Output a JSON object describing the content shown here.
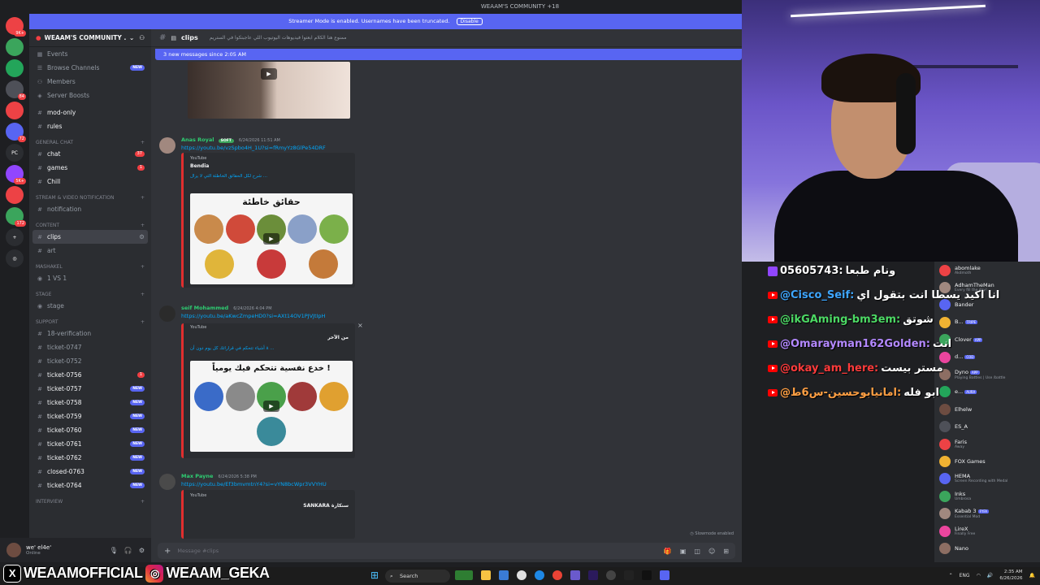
{
  "window": {
    "title": "WEAAM'S COMMUNITY +18"
  },
  "streamer_banner": {
    "text": "Streamer Mode is enabled. Usernames have been truncated.",
    "disable_label": "Disable"
  },
  "servers": [
    {
      "label": "",
      "badge": "9K+"
    },
    {
      "label": "",
      "badge": ""
    },
    {
      "label": "",
      "badge": ""
    },
    {
      "label": "",
      "badge": "84"
    },
    {
      "label": "",
      "badge": ""
    },
    {
      "label": "",
      "badge": "72"
    },
    {
      "label": "PC",
      "badge": ""
    },
    {
      "label": "",
      "badge": "5K+"
    },
    {
      "label": "",
      "badge": ""
    },
    {
      "label": "",
      "badge": "172"
    },
    {
      "label": "+",
      "badge": ""
    },
    {
      "label": "◎",
      "badge": ""
    }
  ],
  "sidebar": {
    "server_name": "WEAAM'S COMMUNITY ...",
    "top_items": [
      {
        "label": "Events",
        "icon": "calendar-icon",
        "new": ""
      },
      {
        "label": "Browse Channels",
        "icon": "browse-icon",
        "new": "NEW"
      },
      {
        "label": "Members",
        "icon": "members-icon",
        "new": ""
      },
      {
        "label": "Server Boosts",
        "icon": "boost-icon",
        "new": ""
      }
    ],
    "channels_a": [
      {
        "label": "mod-only",
        "unread": true
      },
      {
        "label": "rules",
        "unread": true
      }
    ],
    "cat_general": "GENERAL CHAT",
    "general": [
      {
        "label": "chat",
        "badge": "37"
      },
      {
        "label": "games",
        "badge": "1"
      },
      {
        "label": "Chill",
        "badge": ""
      }
    ],
    "cat_stream": "STREAM & VIDEO NOTIFICATION",
    "stream": [
      {
        "label": "notification"
      }
    ],
    "cat_content": "CONTENT",
    "content": [
      {
        "label": "clips"
      },
      {
        "label": "art"
      }
    ],
    "cat_mashakel": "MASHAKEL",
    "mashakel": [
      {
        "label": "1 VS 1"
      }
    ],
    "cat_stage": "STAGE",
    "stage": [
      {
        "label": "stage"
      }
    ],
    "cat_support": "SUPPORT",
    "support": [
      {
        "label": "18-verification",
        "pill": "",
        "unread": false
      },
      {
        "label": "ticket-0747",
        "pill": "",
        "unread": false
      },
      {
        "label": "ticket-0752",
        "pill": "",
        "unread": false
      },
      {
        "label": "ticket-0756",
        "pill": "1",
        "unread": true
      },
      {
        "label": "ticket-0757",
        "pill": "NEW",
        "unread": true
      },
      {
        "label": "ticket-0758",
        "pill": "NEW",
        "unread": true
      },
      {
        "label": "ticket-0759",
        "pill": "NEW",
        "unread": true
      },
      {
        "label": "ticket-0760",
        "pill": "NEW",
        "unread": true
      },
      {
        "label": "ticket-0761",
        "pill": "NEW",
        "unread": true
      },
      {
        "label": "ticket-0762",
        "pill": "NEW",
        "unread": true
      },
      {
        "label": "closed-0763",
        "pill": "NEW",
        "unread": true
      },
      {
        "label": "ticket-0764",
        "pill": "NEW",
        "unread": true
      }
    ],
    "cat_interview": "INTERVIEW"
  },
  "user_panel": {
    "name": "we' el4e'",
    "status": "Online"
  },
  "channel": {
    "name": "clips",
    "topic": "ممنوع هنا الكلام ابعتوا فيديوهات اليوتيوب اللي عاجبتكوا في الستريم",
    "new_messages": "3 new messages since 2:05 AM"
  },
  "messages": [
    {
      "author": "Anas Royal",
      "tag": "SOFT",
      "time": "6/24/2026 11:51 AM",
      "link": "https://youtu.be/vzSpbo4H_1U?si=fRmyYz8GlPe54DRF",
      "provider": "YouTube",
      "embed_title": "Bendia",
      "embed_desc": "شرح لكل الحقائق الخاطئة التي لا يزال ...",
      "thumb_title": "حقائق خاطئة"
    },
    {
      "author": "seif Mohammed",
      "tag": "",
      "time": "6/24/2026 4:04 PM",
      "link": "https://youtu.be/aKwcZmpeHD0?si=AXt14OV1PJVJtIpH",
      "provider": "YouTube",
      "embed_title": "من الآخر",
      "embed_desc": "٨ أشياء تتحكم في قراراتك كل يوم دون أن ...",
      "thumb_title": "خدع نفسية تتحكم فيك يومياً !"
    },
    {
      "author": "Max Payne",
      "tag": "",
      "time": "6/24/2026 5:38 PM",
      "link": "https://youtu.be/Ef3bmvmtnY4?si=vYN8bcWpr3VVYHU",
      "provider": "YouTube",
      "embed_title": "SANKARA سنكارة",
      "embed_desc": "",
      "thumb_title": ""
    }
  ],
  "composer": {
    "placeholder": "Message #clips",
    "slowmode": "Slowmode enabled"
  },
  "yt_chat": [
    {
      "platform": "twitch",
      "user": "05605743:",
      "text": "ونام طبعا",
      "color": "#ffffff"
    },
    {
      "platform": "youtube",
      "user": "@Cisco_Seif:",
      "text": "انا اكيد يسطا انت بتقول اي",
      "color": "#3ea6ff"
    },
    {
      "platform": "youtube",
      "user": "@ikGAming-bm3em:",
      "text": "شوتق",
      "color": "#4cd964"
    },
    {
      "platform": "youtube",
      "user": "@Omarayman162Golden:",
      "text": "انت",
      "color": "#b388ff"
    },
    {
      "platform": "youtube",
      "user": "@okay_am_here:",
      "text": "مستر بيست",
      "color": "#ff3b3b"
    },
    {
      "platform": "youtube",
      "user": "@امانيابوحسين-س6ط:",
      "text": "ابو فله",
      "color": "#ff9f43"
    }
  ],
  "members": [
    {
      "name": "abomlake",
      "status": "Akdmoth",
      "tag": ""
    },
    {
      "name": "AdhamTheMan",
      "status": "Every fill the day!",
      "tag": ""
    },
    {
      "name": "Bander",
      "status": "",
      "tag": ""
    },
    {
      "name": "B...",
      "status": "",
      "tag": "TRIPE"
    },
    {
      "name": "Clover",
      "status": "",
      "tag": "APP"
    },
    {
      "name": "d...",
      "status": "",
      "tag": "COD"
    },
    {
      "name": "Dyno",
      "status": "Playing Battles | Use /battle",
      "tag": "APP"
    },
    {
      "name": "e...",
      "status": "",
      "tag": "AURA"
    },
    {
      "name": "Elhelw",
      "status": "",
      "tag": ""
    },
    {
      "name": "ES_A",
      "status": "",
      "tag": ""
    },
    {
      "name": "Faris",
      "status": "Away",
      "tag": ""
    },
    {
      "name": "FOX Games",
      "status": "",
      "tag": ""
    },
    {
      "name": "HEMA",
      "status": "Screen Recording with Medal",
      "tag": ""
    },
    {
      "name": "Inks",
      "status": "Umbrosa",
      "tag": ""
    },
    {
      "name": "Kabab 3",
      "status": "Essential Mod",
      "tag": "FYFA"
    },
    {
      "name": "LireX",
      "status": "Finally Free",
      "tag": ""
    },
    {
      "name": "Nano",
      "status": "",
      "tag": ""
    }
  ],
  "socials": [
    {
      "icon": "x-icon",
      "handle": "WEAAMOFFICIAL"
    },
    {
      "icon": "instagram-icon",
      "handle": "WEAAM_GEKA"
    }
  ],
  "taskbar": {
    "search": "Search",
    "time": "2:35 AM",
    "date": "6/26/2026",
    "lang": "ENG"
  }
}
